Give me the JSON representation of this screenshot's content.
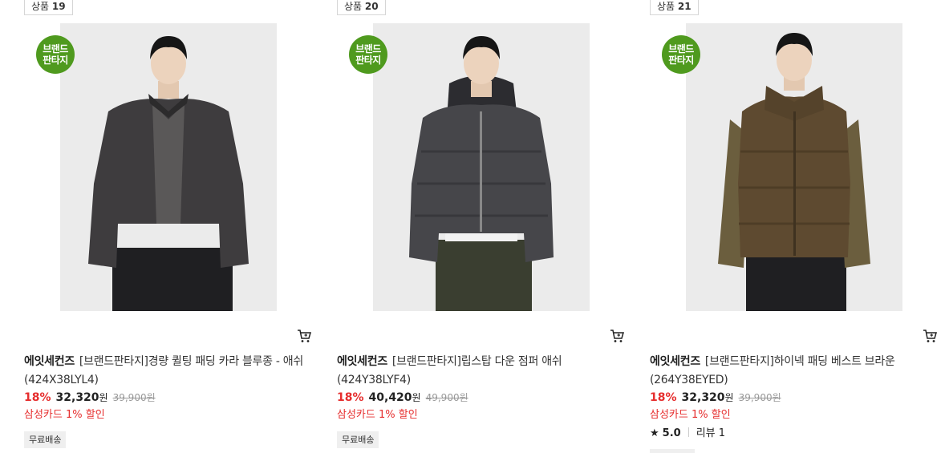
{
  "colors": {
    "discount": "#e62e2e",
    "brand_tag": "#4f9a1e",
    "thumb_bg": "#ebebeb"
  },
  "products": [
    {
      "rank_label": "상품",
      "rank_number": "19",
      "brand_tag": [
        "브랜드",
        "판타지"
      ],
      "brand": "에잇세컨즈",
      "name": "[브랜드판타지]경량 퀼팅 패딩 카라 블루종 - 애쉬 (424X38LYL4)",
      "discount_rate": "18%",
      "price": "32,320",
      "currency": "원",
      "original_price": "39,900",
      "original_currency": "원",
      "card_promo": "삼성카드 1% 할인",
      "shipping": "무료배송",
      "garment_color": "#3e3c3e",
      "cart_icon": "cart-icon"
    },
    {
      "rank_label": "상품",
      "rank_number": "20",
      "brand_tag": [
        "브랜드",
        "판타지"
      ],
      "brand": "에잇세컨즈",
      "name": "[브랜드판타지]립스탑 다운 점퍼 애쉬 (424Y38LYF4)",
      "discount_rate": "18%",
      "price": "40,420",
      "currency": "원",
      "original_price": "49,900",
      "original_currency": "원",
      "card_promo": "삼성카드 1% 할인",
      "shipping": "무료배송",
      "garment_color": "#46464a",
      "cart_icon": "cart-icon"
    },
    {
      "rank_label": "상품",
      "rank_number": "21",
      "brand_tag": [
        "브랜드",
        "판타지"
      ],
      "brand": "에잇세컨즈",
      "name": "[브랜드판타지]하이넥 패딩 베스트 브라운 (264Y38EYED)",
      "discount_rate": "18%",
      "price": "32,320",
      "currency": "원",
      "original_price": "39,900",
      "original_currency": "원",
      "card_promo": "삼성카드 1% 할인",
      "rating_star": "★",
      "rating_score": "5.0",
      "review_label": "리뷰 1",
      "garment_color": "#5e4a30",
      "cart_icon": "cart-icon"
    }
  ]
}
